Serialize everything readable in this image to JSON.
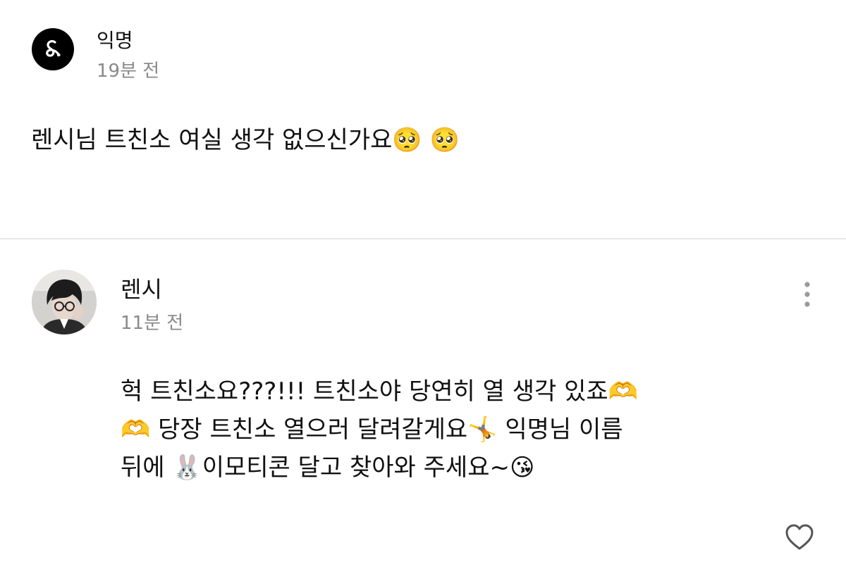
{
  "question": {
    "author": "익명",
    "time": "19분 전",
    "text": "렌시님 트친소 여실 생각 없으신가요🥺 🥺",
    "avatar_icon": "ampersand-logo-icon"
  },
  "answer": {
    "author": "렌시",
    "time": "11분 전",
    "text": "헉 트친소요???!!! 트친소야 당연히 열 생각 있죠🫶\n🫶 당장 트친소 열으러 달려갈게요🤸 익명님 이름\n뒤에 🐰이모티콘 달고 찾아와 주세요~😘",
    "avatar_icon": "profile-photo",
    "more_icon": "kebab-menu-icon",
    "like_icon": "heart-icon"
  },
  "colors": {
    "text": "#111111",
    "muted": "#8a8a8a",
    "divider": "#e6e6e6",
    "avatar_bg": "#000000"
  }
}
